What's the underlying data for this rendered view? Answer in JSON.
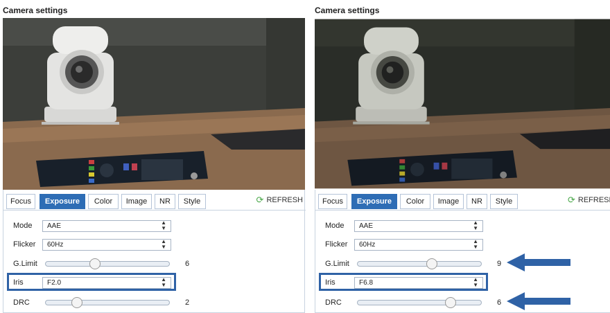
{
  "panels": [
    {
      "title": "Camera settings",
      "tabs": [
        "Focus",
        "Exposure",
        "Color",
        "Image",
        "NR",
        "Style"
      ],
      "active_tab": "Exposure",
      "refresh_label": "REFRESH",
      "refresh_icon": "refresh-icon",
      "mode": {
        "label": "Mode",
        "value": "AAE"
      },
      "flicker": {
        "label": "Flicker",
        "value": "60Hz"
      },
      "glimit": {
        "label": "G.Limit",
        "value": "6",
        "level": 0.4
      },
      "iris": {
        "label": "Iris",
        "value": "F2.0"
      },
      "drc": {
        "label": "DRC",
        "value": "2",
        "level": 0.25
      }
    },
    {
      "title": "Camera settings",
      "tabs": [
        "Focus",
        "Exposure",
        "Color",
        "Image",
        "NR",
        "Style"
      ],
      "active_tab": "Exposure",
      "refresh_label": "REFRESH",
      "refresh_icon": "refresh-icon",
      "mode": {
        "label": "Mode",
        "value": "AAE"
      },
      "flicker": {
        "label": "Flicker",
        "value": "60Hz"
      },
      "glimit": {
        "label": "G.Limit",
        "value": "9",
        "level": 0.6
      },
      "iris": {
        "label": "Iris",
        "value": "F6.8"
      },
      "drc": {
        "label": "DRC",
        "value": "6",
        "level": 0.75
      }
    }
  ],
  "colors": {
    "accent": "#2e6db5",
    "highlight": "#2f62a6",
    "arrow": "#2f62a6",
    "refresh": "#4aa84a"
  }
}
